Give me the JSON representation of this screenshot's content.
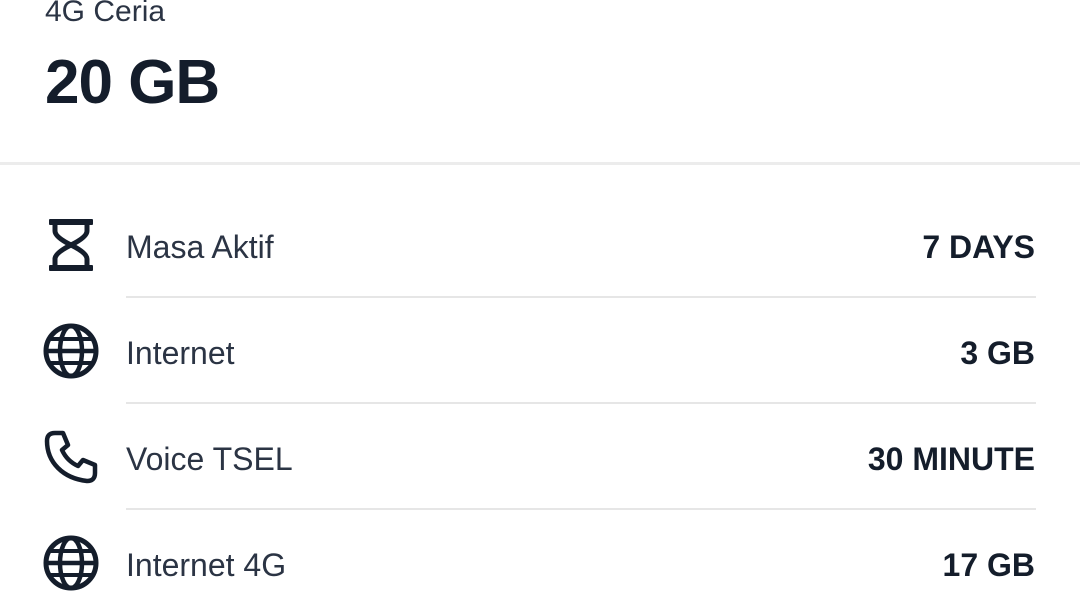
{
  "package": {
    "subtitle": "4G Ceria",
    "quota": "20 GB"
  },
  "details": [
    {
      "icon": "hourglass-icon",
      "label": "Masa Aktif",
      "value": "7 DAYS"
    },
    {
      "icon": "globe-icon",
      "label": "Internet",
      "value": "3 GB"
    },
    {
      "icon": "phone-icon",
      "label": "Voice TSEL",
      "value": "30 MINUTE"
    },
    {
      "icon": "globe-icon",
      "label": "Internet 4G",
      "value": "17 GB"
    }
  ],
  "colors": {
    "text_primary": "#141d2b",
    "text_secondary": "#2b3444",
    "divider": "#e6e6e6",
    "background": "#ffffff"
  }
}
